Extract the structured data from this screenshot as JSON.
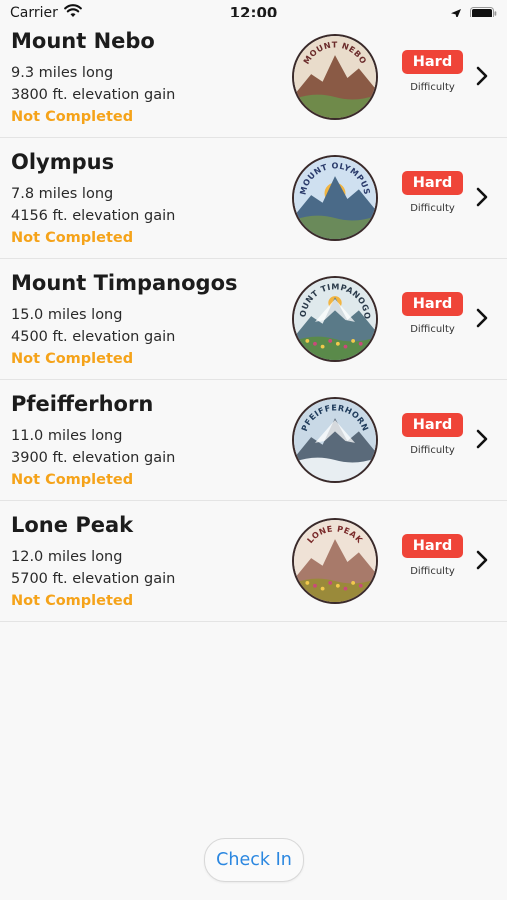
{
  "status_bar": {
    "carrier": "Carrier",
    "time": "12:00",
    "icons": [
      "wifi-icon",
      "location-arrow-icon",
      "battery-icon"
    ]
  },
  "trails": [
    {
      "name": "Mount Nebo",
      "length": "9.3 miles long",
      "gain": "3800 ft. elevation gain",
      "status": "Not Completed",
      "difficulty": "Hard",
      "difficulty_caption": "Difficulty",
      "badge_text": "MOUNT NEBO",
      "badge_icon": "mount-nebo-badge-icon",
      "badge_sky": "#e9dccb",
      "badge_mountain": "#8a5a45",
      "badge_ground": "#6f8a4a",
      "badge_text_color": "#6a2a2a"
    },
    {
      "name": "Olympus",
      "length": "7.8 miles long",
      "gain": "4156 ft. elevation gain",
      "status": "Not Completed",
      "difficulty": "Hard",
      "difficulty_caption": "Difficulty",
      "badge_text": "MOUNT OLYMPUS",
      "badge_icon": "mount-olympus-badge-icon",
      "badge_sky": "#cfe0f0",
      "badge_mountain": "#4a6a88",
      "badge_ground": "#6a8a5a",
      "badge_text_color": "#2a3a6a"
    },
    {
      "name": "Mount Timpanogos",
      "length": "15.0 miles long",
      "gain": "4500 ft. elevation gain",
      "status": "Not Completed",
      "difficulty": "Hard",
      "difficulty_caption": "Difficulty",
      "badge_text": "MOUNT TIMPANOGOS",
      "badge_icon": "mount-timpanogos-badge-icon",
      "badge_sky": "#dfe9ec",
      "badge_mountain": "#5a7a88",
      "badge_ground": "#5a8a4a",
      "badge_text_color": "#2a3a4a"
    },
    {
      "name": "Pfeifferhorn",
      "length": "11.0 miles long",
      "gain": "3900 ft. elevation gain",
      "status": "Not Completed",
      "difficulty": "Hard",
      "difficulty_caption": "Difficulty",
      "badge_text": "PFEIFFERHORN",
      "badge_icon": "pfeifferhorn-badge-icon",
      "badge_sky": "#c9d9e6",
      "badge_mountain": "#5a6a7a",
      "badge_ground": "#e8eef2",
      "badge_text_color": "#1e3a5a"
    },
    {
      "name": "Lone Peak",
      "length": "12.0 miles long",
      "gain": "5700 ft. elevation gain",
      "status": "Not Completed",
      "difficulty": "Hard",
      "difficulty_caption": "Difficulty",
      "badge_text": "LONE PEAK",
      "badge_icon": "lone-peak-badge-icon",
      "badge_sky": "#efe2d6",
      "badge_mountain": "#a87a6a",
      "badge_ground": "#9a8a3a",
      "badge_text_color": "#7a2a2a"
    }
  ],
  "check_in_label": "Check In",
  "colors": {
    "hard": "#ef4438",
    "not_completed": "#f5a31a",
    "check_in_text": "#2b87e0"
  }
}
